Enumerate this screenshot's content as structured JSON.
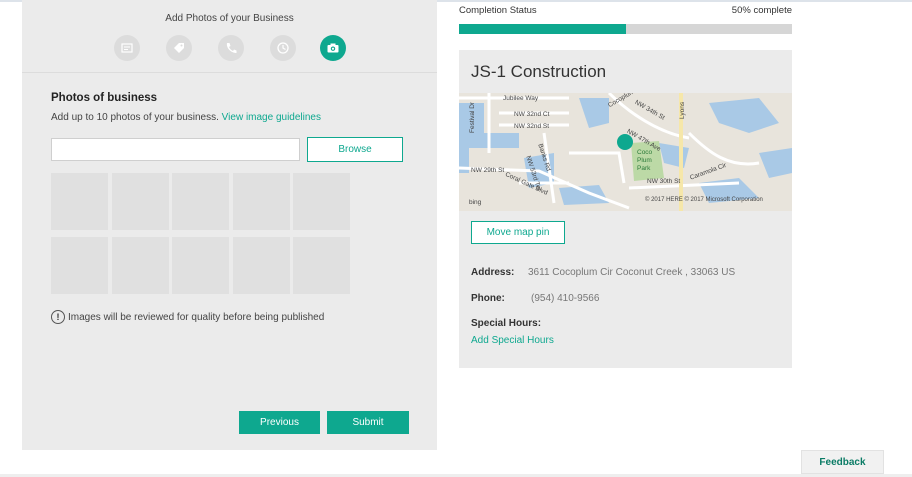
{
  "steps": {
    "title": "Add Photos of your Business",
    "icons": [
      "business-card-icon",
      "tag-icon",
      "phone-icon",
      "clock-icon",
      "camera-icon"
    ],
    "active_index": 4
  },
  "photos": {
    "heading": "Photos of business",
    "description": "Add up to 10 photos of your business.",
    "guidelines_link": "View image guidelines",
    "file_input_value": "",
    "browse_label": "Browse",
    "slots": 10,
    "notice": "Images will be reviewed for quality before being published"
  },
  "actions": {
    "previous_label": "Previous",
    "submit_label": "Submit"
  },
  "completion": {
    "label": "Completion Status",
    "percent_text": "50% complete",
    "percent": 50
  },
  "business": {
    "name": "JS-1 Construction",
    "map_labels": {
      "jubilee": "Jubilee Way",
      "festival": "Festival Dr",
      "nw32ct": "NW 32nd Ct",
      "nw32st": "NW 32nd St",
      "nw34th": "NW 34th St",
      "lyons": "Lyons",
      "nw47th": "NW 47th Ave",
      "banks": "Banks Rd",
      "nw53": "NW 53rd Ter",
      "coco_park": "Coco\nPlum\nPark",
      "nw29th": "NW 29th St",
      "coral": "Coral Gate Blvd",
      "nw30th": "NW 30th St",
      "caramola": "Caramola Cir",
      "cocoplum": "Cocoplum",
      "bing": "bing",
      "copyright": "© 2017 HERE   © 2017 Microsoft Corporation"
    },
    "move_pin_label": "Move map pin",
    "address_label": "Address:",
    "address_value": "3611 Cocoplum Cir Coconut Creek ,  33063 US",
    "phone_label": "Phone:",
    "phone_value": "(954) 410-9566",
    "special_hours_label": "Special Hours:",
    "add_special_hours": "Add Special Hours"
  },
  "feedback_label": "Feedback",
  "colors": {
    "accent": "#0ea88f",
    "panel": "#ebebeb",
    "progress_track": "#d6d6d6"
  }
}
